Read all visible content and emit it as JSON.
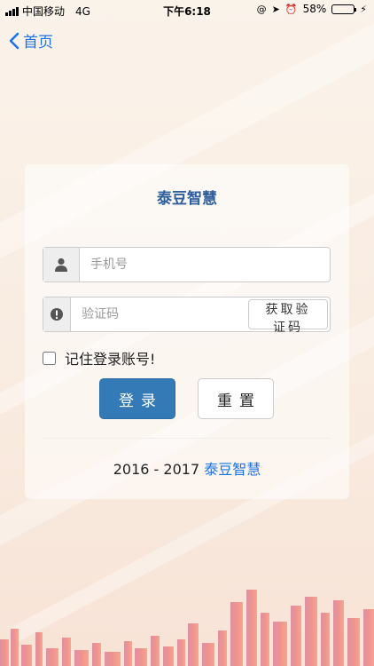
{
  "status_bar": {
    "carrier": "中国移动",
    "network": "4G",
    "time": "下午6:18",
    "battery": "58%",
    "battery_level": 0.58
  },
  "nav": {
    "back_label": "首页"
  },
  "card": {
    "title": "泰豆智慧",
    "phone_placeholder": "手机号",
    "code_placeholder": "验证码",
    "get_code_label": "获取验证码",
    "remember_label": "记住登录账号!",
    "login_label": "登录",
    "reset_label": "重置",
    "footer_years": "2016 - 2017",
    "footer_brand": "泰豆智慧"
  },
  "colors": {
    "accent": "#337ab7",
    "link": "#1a73e8",
    "title": "#2f5f9e"
  }
}
